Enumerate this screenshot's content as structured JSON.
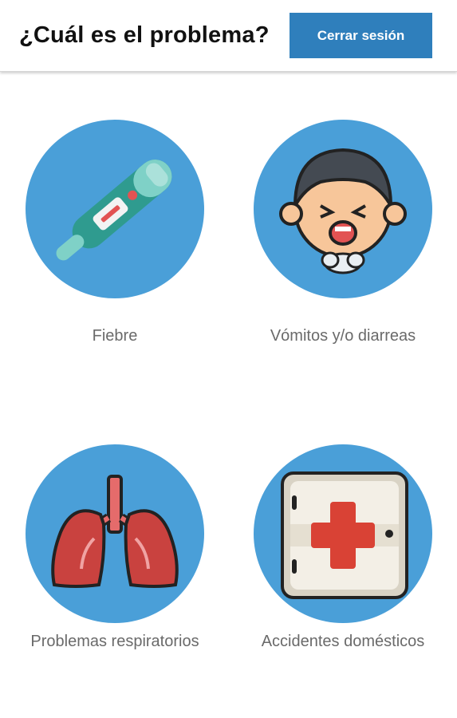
{
  "header": {
    "title": "¿Cuál es el problema?",
    "logout_label": "Cerrar sesión"
  },
  "options": [
    {
      "label": "Fiebre",
      "icon": "thermometer-icon"
    },
    {
      "label": "Vómitos y/o diarreas",
      "icon": "vomiting-face-icon"
    },
    {
      "label": "Problemas respiratorios",
      "icon": "lungs-icon"
    },
    {
      "label": "Accidentes domésticos",
      "icon": "first-aid-kit-icon"
    }
  ],
  "colors": {
    "accent": "#2f7fbc",
    "circle": "#4a9fd8",
    "label": "#6a6a6a"
  }
}
